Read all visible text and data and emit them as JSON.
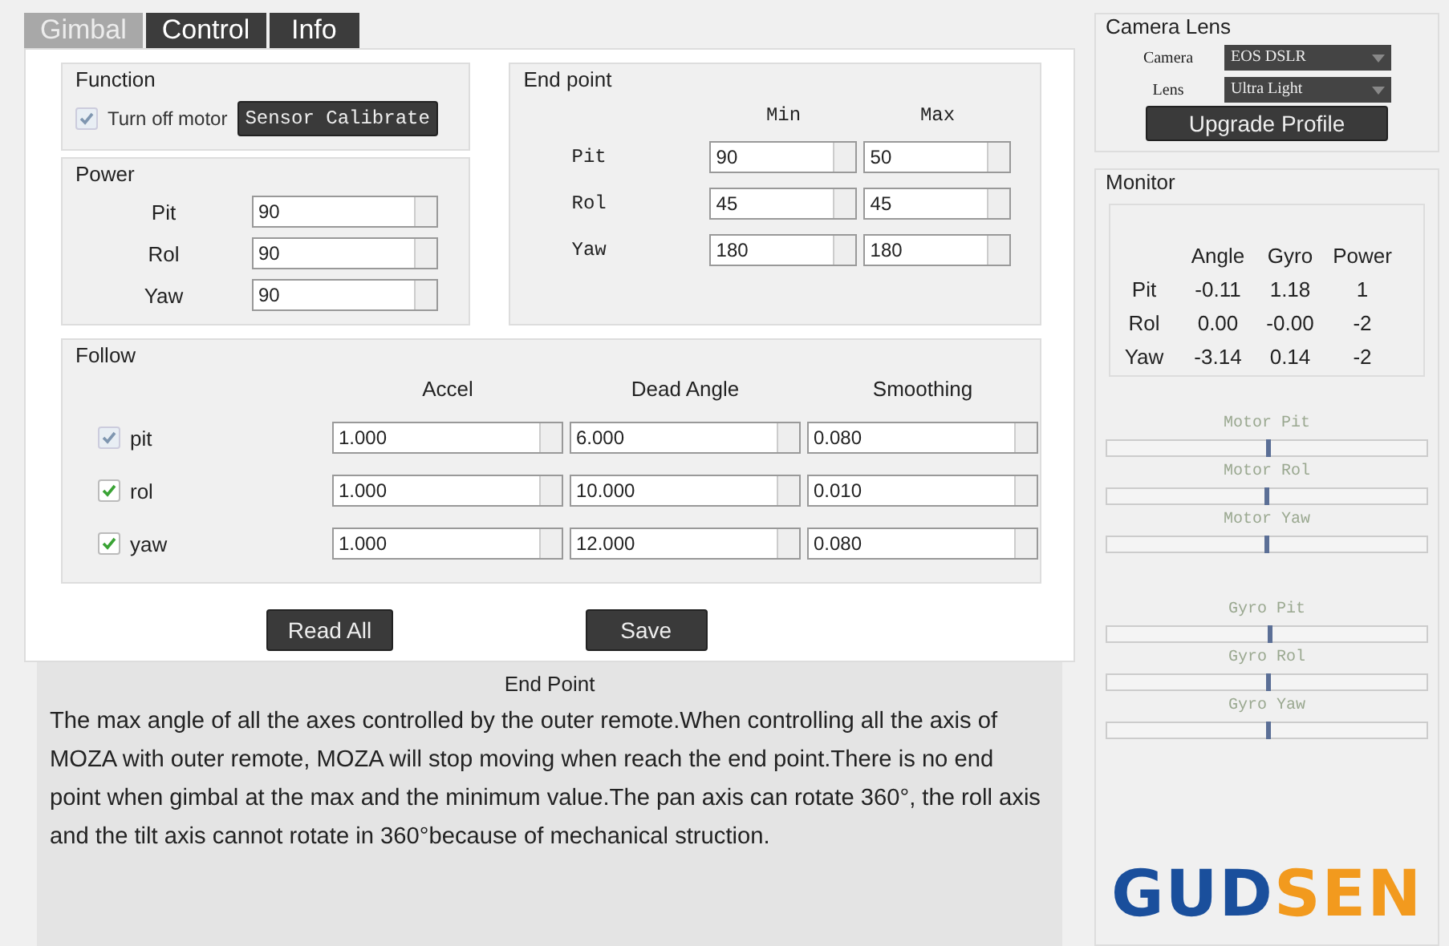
{
  "tabs": [
    {
      "label": "Gimbal",
      "selected": true
    },
    {
      "label": "Control",
      "selected": false
    },
    {
      "label": "Info",
      "selected": false
    }
  ],
  "function": {
    "title": "Function",
    "turn_off_motor": {
      "label": "Turn off motor",
      "checked": true,
      "disabled": true
    },
    "button": "Sensor Calibrate"
  },
  "power": {
    "title": "Power",
    "rows": [
      {
        "label": "Pit",
        "value": "90"
      },
      {
        "label": "Rol",
        "value": "90"
      },
      {
        "label": "Yaw",
        "value": "90"
      }
    ]
  },
  "end_point": {
    "title": "End point",
    "columns": [
      "Min",
      "Max"
    ],
    "rows": [
      {
        "label": "Pit",
        "min": "90",
        "max": "50"
      },
      {
        "label": "Rol",
        "min": "45",
        "max": "45"
      },
      {
        "label": "Yaw",
        "min": "180",
        "max": "180"
      }
    ]
  },
  "follow": {
    "title": "Follow",
    "columns": [
      "Accel",
      "Dead Angle",
      "Smoothing"
    ],
    "rows": [
      {
        "label": "pit",
        "checked": true,
        "disabled": true,
        "accel": "1.000",
        "dead_angle": "6.000",
        "smoothing": "0.080"
      },
      {
        "label": "rol",
        "checked": true,
        "disabled": false,
        "accel": "1.000",
        "dead_angle": "10.000",
        "smoothing": "0.010"
      },
      {
        "label": "yaw",
        "checked": true,
        "disabled": false,
        "accel": "1.000",
        "dead_angle": "12.000",
        "smoothing": "0.080"
      }
    ]
  },
  "buttons": [
    "Read All",
    "Save"
  ],
  "help": {
    "title": "End Point",
    "text": "The max angle of all the axes controlled by the outer remote.When controlling all the axis of MOZA with outer remote, MOZA will stop moving when reach the end point.There is no end point when gimbal at the max and the minimum value.The pan axis can rotate 360°, the roll axis and the tilt axis cannot rotate in 360°because of mechanical struction."
  },
  "camera_lens": {
    "title": "Camera Lens",
    "camera": {
      "label": "Camera",
      "value": "EOS DSLR"
    },
    "lens": {
      "label": "Lens",
      "value": "Ultra Light"
    },
    "button": "Upgrade Profile"
  },
  "monitor": {
    "title": "Monitor",
    "columns": [
      "Angle",
      "Gyro",
      "Power"
    ],
    "rows": [
      {
        "label": "Pit",
        "angle": "-0.11",
        "gyro": "1.18",
        "power": "1"
      },
      {
        "label": "Rol",
        "angle": "0.00",
        "gyro": "-0.00",
        "power": "-2"
      },
      {
        "label": "Yaw",
        "angle": "-3.14",
        "gyro": "0.14",
        "power": "-2"
      }
    ],
    "motor_bars": [
      {
        "label": "Motor Pit",
        "level": 0.5
      },
      {
        "label": "Motor Rol",
        "level": 0.495
      },
      {
        "label": "Motor Yaw",
        "level": 0.495
      }
    ],
    "gyro_bars": [
      {
        "label": "Gyro Pit",
        "level": 0.51
      },
      {
        "label": "Gyro Rol",
        "level": 0.5
      },
      {
        "label": "Gyro Yaw",
        "level": 0.5
      }
    ]
  },
  "logo": {
    "first": "GUD",
    "second": "SEN"
  }
}
